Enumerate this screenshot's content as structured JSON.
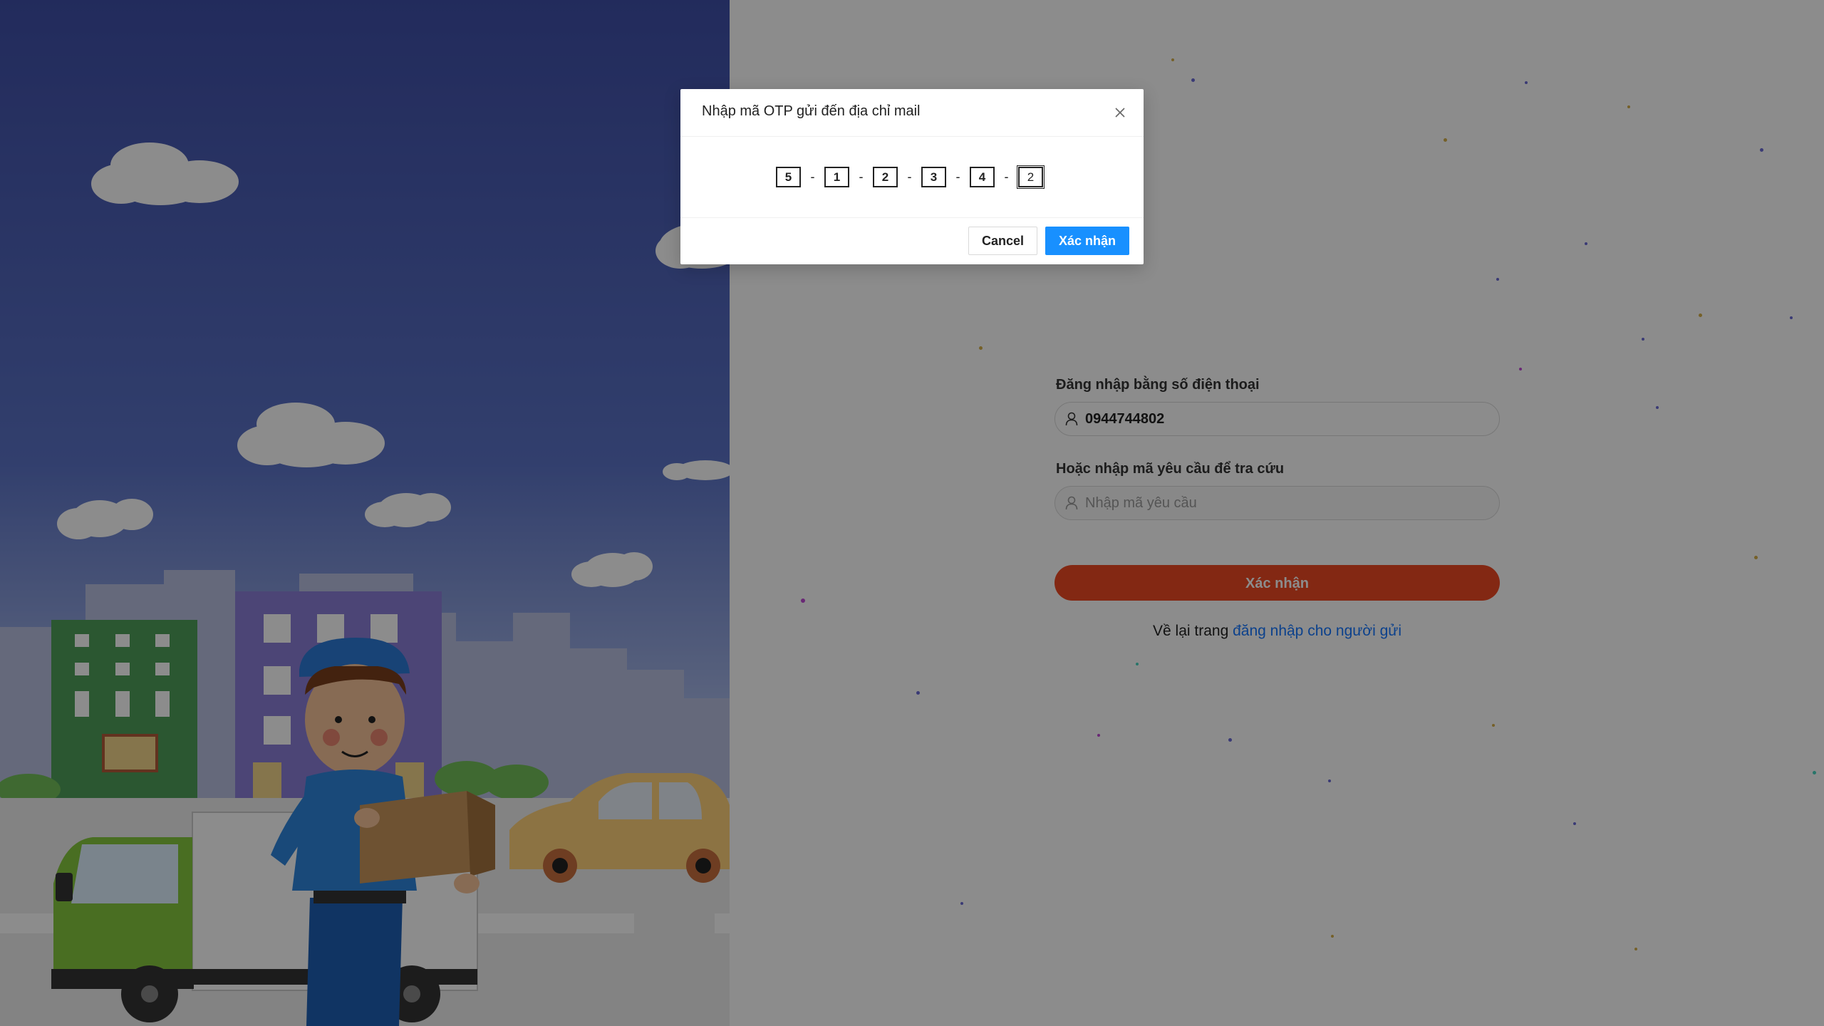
{
  "login": {
    "phone_label": "Đăng nhập bằng số điện thoại",
    "phone_value": "0944744802",
    "code_label": "Hoặc nhập mã yêu cầu để tra cứu",
    "code_placeholder": "Nhập mã yêu cầu",
    "submit_label": "Xác nhận",
    "back_prefix": "Về lại trang",
    "back_link": "đăng nhập cho người gửi"
  },
  "modal": {
    "title": "Nhập mã OTP gửi đến địa chỉ mail",
    "otp_digits": [
      "5",
      "1",
      "2",
      "3",
      "4",
      "2"
    ],
    "separator": "-",
    "cancel_label": "Cancel",
    "confirm_label": "Xác nhận"
  },
  "colors": {
    "primary": "#1890ff",
    "submit": "#ef4a24",
    "link": "#1677ff",
    "sky": "#3b4c93"
  },
  "icons": {
    "close": "close-icon",
    "user": "user-icon"
  }
}
